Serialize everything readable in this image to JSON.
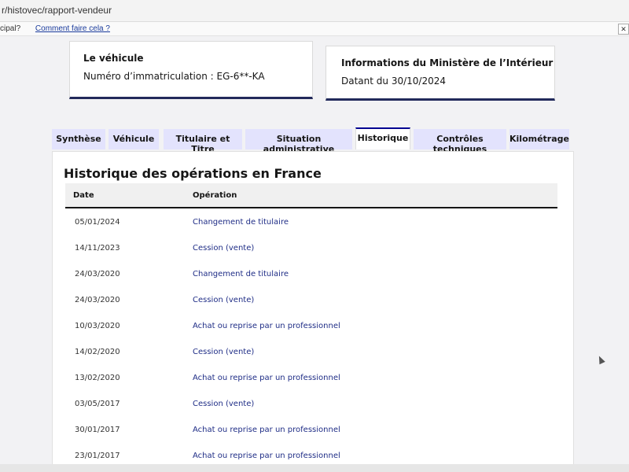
{
  "browser": {
    "url": "r/histovec/rapport-vendeur",
    "infobar_left": "cipal?",
    "infobar_link": "Comment faire cela ?"
  },
  "vehicle_card": {
    "title": "Le véhicule",
    "plate": "Numéro d’immatriculation : EG-6**-KA"
  },
  "ministry_card": {
    "title": "Informations du Ministère de l’Intérieur",
    "date": "Datant du 30/10/2024"
  },
  "tabs": [
    {
      "label": "Synthèse"
    },
    {
      "label": "Véhicule"
    },
    {
      "label": "Titulaire et Titre"
    },
    {
      "label": "Situation administrative"
    },
    {
      "label": "Historique"
    },
    {
      "label": "Contrôles techniques"
    },
    {
      "label": "Kilométrage"
    }
  ],
  "active_tab": "Historique",
  "history": {
    "title": "Historique des opérations en France",
    "columns": {
      "date": "Date",
      "operation": "Opération"
    },
    "rows": [
      {
        "date": "05/01/2024",
        "operation": "Changement de titulaire"
      },
      {
        "date": "14/11/2023",
        "operation": "Cession (vente)"
      },
      {
        "date": "24/03/2020",
        "operation": "Changement de titulaire"
      },
      {
        "date": "24/03/2020",
        "operation": "Cession (vente)"
      },
      {
        "date": "10/03/2020",
        "operation": "Achat ou reprise par un professionnel"
      },
      {
        "date": "14/02/2020",
        "operation": "Cession (vente)"
      },
      {
        "date": "13/02/2020",
        "operation": "Achat ou reprise par un professionnel"
      },
      {
        "date": "03/05/2017",
        "operation": "Cession (vente)"
      },
      {
        "date": "30/01/2017",
        "operation": "Achat ou reprise par un professionnel"
      },
      {
        "date": "23/01/2017",
        "operation": "Achat ou reprise par un professionnel"
      }
    ]
  },
  "colors": {
    "accent": "#000091",
    "tab_bg": "#e3e3fd",
    "card_border": "#222a5b",
    "link": "#1f2d86"
  }
}
